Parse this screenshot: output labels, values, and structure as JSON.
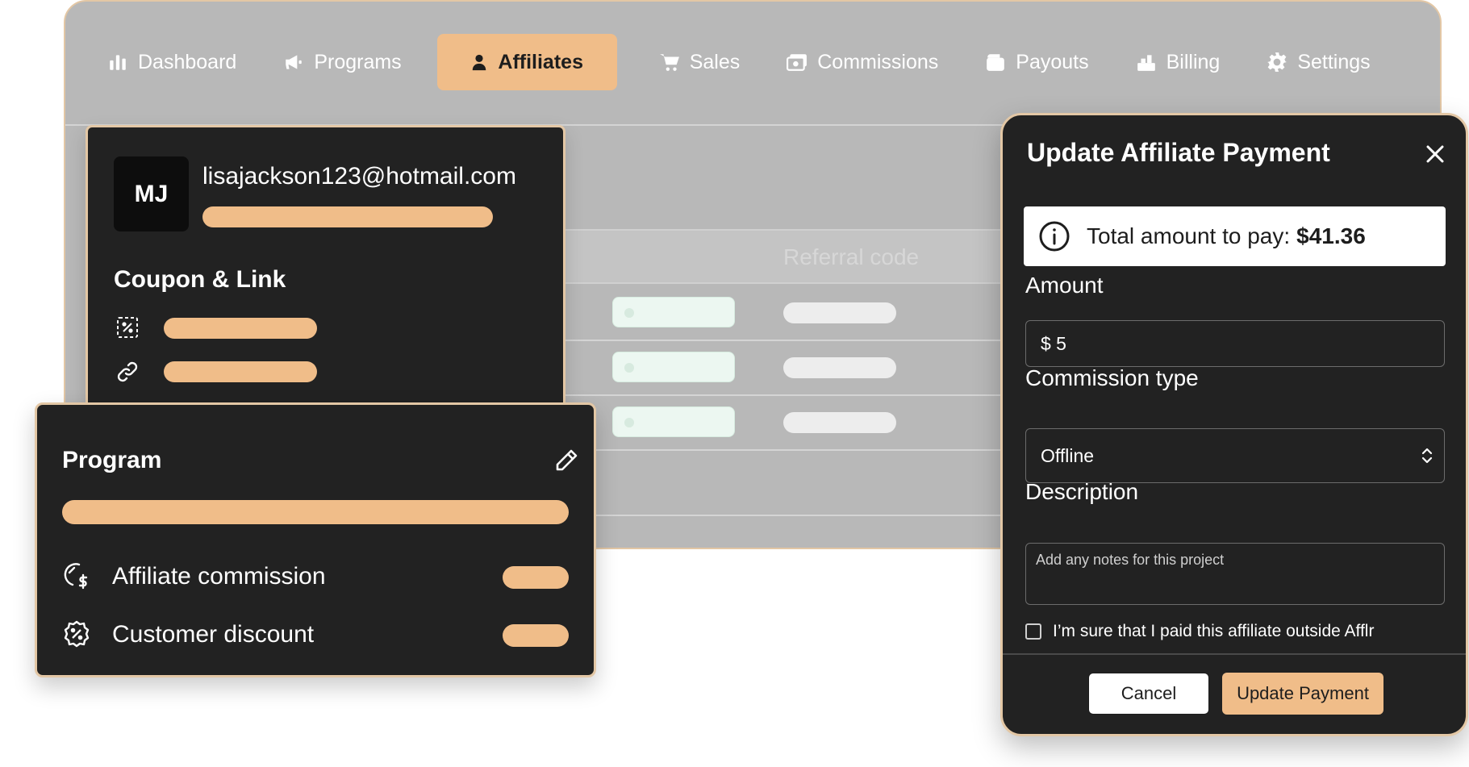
{
  "nav": {
    "items": [
      {
        "label": "Dashboard",
        "icon": "bar-chart-icon"
      },
      {
        "label": "Programs",
        "icon": "megaphone-icon"
      },
      {
        "label": "Affiliates",
        "icon": "user-icon",
        "active": true
      },
      {
        "label": "Sales",
        "icon": "cart-icon"
      },
      {
        "label": "Commissions",
        "icon": "cash-icon"
      },
      {
        "label": "Payouts",
        "icon": "wallet-icon"
      },
      {
        "label": "Billing",
        "icon": "billing-icon"
      },
      {
        "label": "Settings",
        "icon": "gear-icon"
      }
    ]
  },
  "table": {
    "column_header": "Referral code"
  },
  "profile": {
    "initials": "MJ",
    "email": "lisajackson123@hotmail.com",
    "section_title": "Coupon & Link",
    "coupon_icon": "coupon-icon",
    "link_icon": "link-icon"
  },
  "program": {
    "title": "Program",
    "edit_icon": "pencil-icon",
    "affiliate_commission_label": "Affiliate commission",
    "affiliate_commission_icon": "commission-icon",
    "customer_discount_label": "Customer discount",
    "customer_discount_icon": "discount-badge-icon"
  },
  "modal": {
    "title": "Update Affiliate Payment",
    "close_icon": "close-icon",
    "info_icon": "info-icon",
    "total_label": "Total amount to pay:",
    "total_value": "$41.36",
    "amount_label": "Amount",
    "amount_value": "$ 5",
    "commission_type_label": "Commission type",
    "commission_type_value": "Offline",
    "description_label": "Description",
    "description_placeholder": "Add any notes for this project",
    "confirm_label": "I’m sure that I paid this affiliate outside Afflr",
    "cancel_label": "Cancel",
    "submit_label": "Update Payment"
  },
  "colors": {
    "accent": "#f0bd89",
    "card": "#222222",
    "border": "#e3c7a5",
    "backdrop": "#b8b8b8"
  }
}
